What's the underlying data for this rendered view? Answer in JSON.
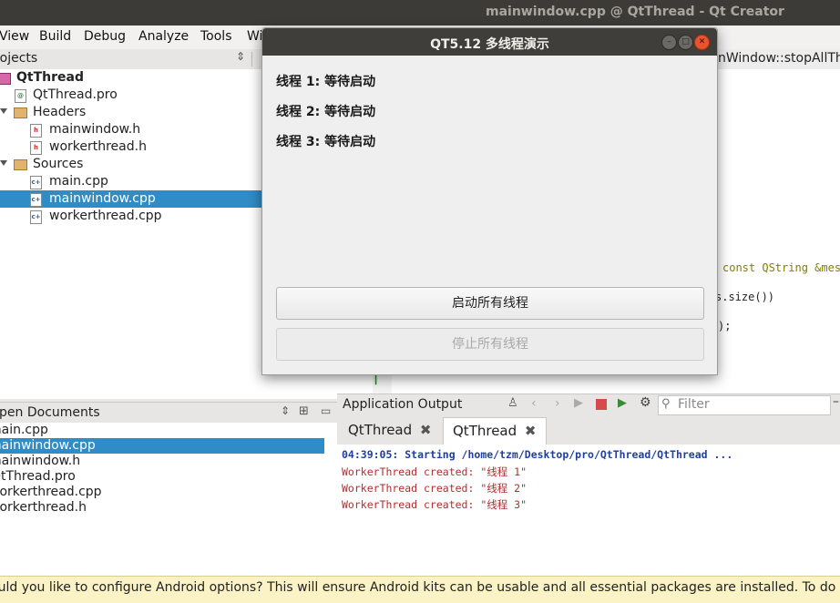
{
  "window": {
    "title": "mainwindow.cpp @ QtThread - Qt Creator"
  },
  "menu": [
    "View",
    "Build",
    "Debug",
    "Analyze",
    "Tools",
    "Wi"
  ],
  "projects": {
    "header": "Projects",
    "items": [
      {
        "label": "QtThread",
        "kind": "project",
        "bold": true
      },
      {
        "label": "QtThread.pro",
        "kind": "pro"
      },
      {
        "label": "Headers",
        "kind": "folder"
      },
      {
        "label": "mainwindow.h",
        "kind": "h"
      },
      {
        "label": "workerthread.h",
        "kind": "h"
      },
      {
        "label": "Sources",
        "kind": "folder"
      },
      {
        "label": "main.cpp",
        "kind": "cpp"
      },
      {
        "label": "mainwindow.cpp",
        "kind": "cpp",
        "selected": true
      },
      {
        "label": "workerthread.cpp",
        "kind": "cpp"
      }
    ]
  },
  "editor": {
    "function_fragment": "nWindow::stopAllTh",
    "code_fragments": [
      "const QString &mes",
      "s.size())",
      ");"
    ],
    "line_marker": "|"
  },
  "open_documents": {
    "header": "Open Documents",
    "items": [
      "main.cpp",
      "mainwindow.cpp",
      "mainwindow.h",
      "QtThread.pro",
      "workerthread.cpp",
      "workerthread.h"
    ],
    "selected_index": 1
  },
  "app_output": {
    "title": "Application Output",
    "filter_placeholder": "Filter",
    "tabs": [
      "QtThread",
      "QtThread"
    ],
    "lines": [
      {
        "text": "04:39:05: Starting /home/tzm/Desktop/pro/QtThread/QtThread ...",
        "color": "#1f3fa3",
        "bold": true
      },
      {
        "text": "WorkerThread created: \"线程 1\"",
        "color": "#b32d2d"
      },
      {
        "text": "WorkerThread created: \"线程 2\"",
        "color": "#b32d2d"
      },
      {
        "text": "WorkerThread created: \"线程 3\"",
        "color": "#b32d2d"
      }
    ]
  },
  "info_bar": {
    "text": "Would you like to configure Android options? This will ensure Android kits can be usable and all essential packages are installed. To do it later, select Options > Devices > Android"
  },
  "dialog": {
    "title": "QT5.12 多线程演示",
    "threads": [
      "线程 1: 等待启动",
      "线程 2: 等待启动",
      "线程 3: 等待启动"
    ],
    "start_button": "启动所有线程",
    "stop_button": "停止所有线程"
  },
  "colors": {
    "selection": "#308cc6",
    "keyword": "#808000",
    "type": "#800080",
    "dialog_title": "#3f3e3a"
  }
}
